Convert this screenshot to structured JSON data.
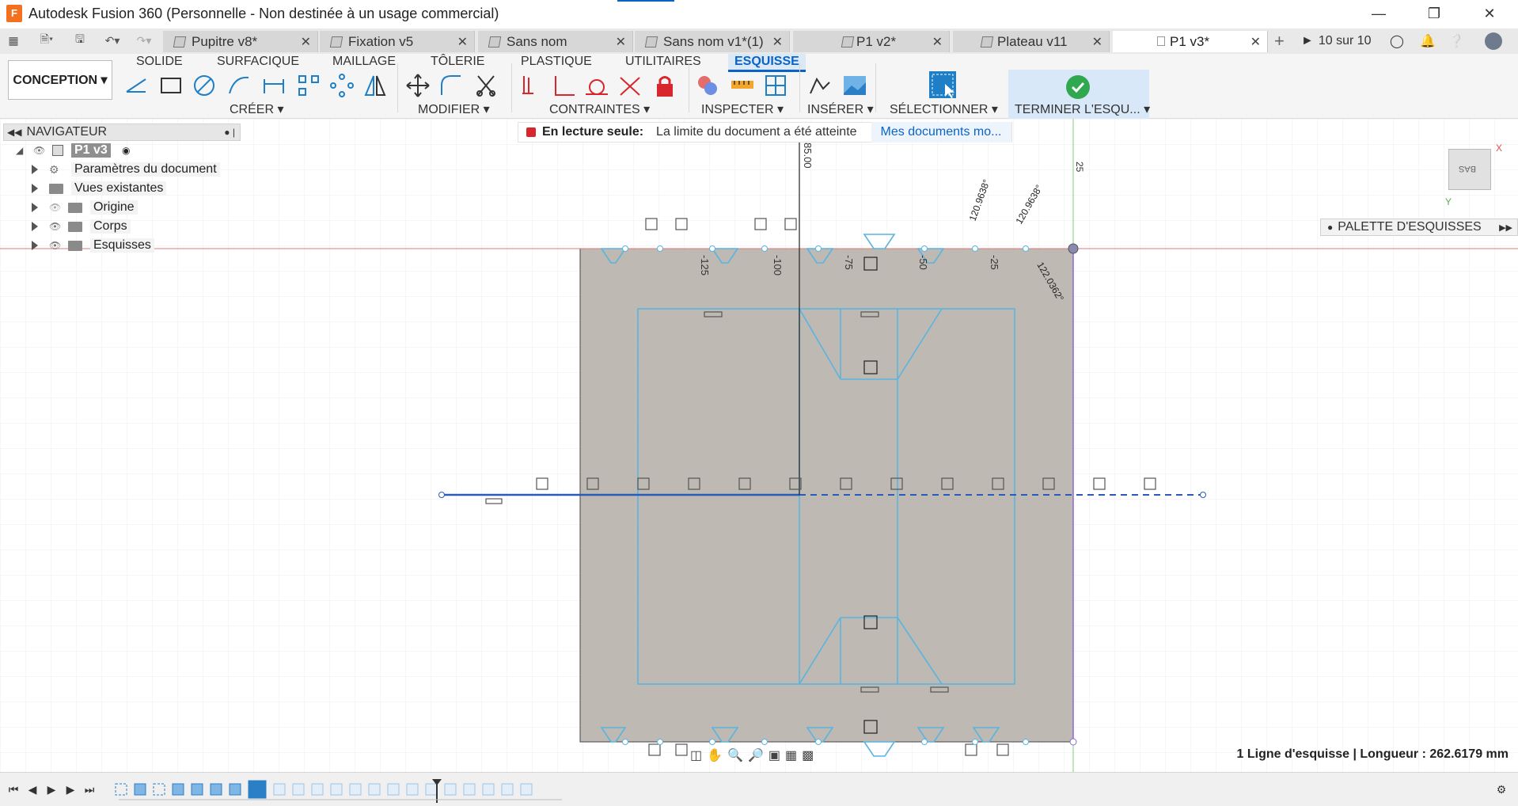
{
  "window": {
    "app_badge": "F",
    "title": "Autodesk Fusion 360 (Personnelle - Non destinée à un usage commercial)",
    "minimize_icon": "minimize-icon",
    "maximize_icon": "restore-icon",
    "close_icon": "close-icon"
  },
  "doc_tabs": [
    {
      "label": "Pupitre v8*"
    },
    {
      "label": "Fixation v5"
    },
    {
      "label": "Sans nom"
    },
    {
      "label": "Sans nom v1*(1)"
    },
    {
      "label": "P1 v2*"
    },
    {
      "label": "Plateau v11"
    },
    {
      "label": "P1 v3*",
      "active": true
    }
  ],
  "tab_strip": {
    "job_status": "10 sur 10"
  },
  "ribbon": {
    "workspace": "CONCEPTION ▾",
    "tabs": [
      "SOLIDE",
      "SURFACIQUE",
      "MAILLAGE",
      "TÔLERIE",
      "PLASTIQUE",
      "UTILITAIRES",
      "ESQUISSE"
    ],
    "active_tab": "ESQUISSE",
    "groups": {
      "create": "CRÉER ▾",
      "modify": "MODIFIER ▾",
      "constraints": "CONTRAINTES ▾",
      "inspect": "INSPECTER ▾",
      "insert": "INSÉRER ▾",
      "select": "SÉLECTIONNER ▾",
      "finish": "TERMINER L'ESQU... ▾"
    }
  },
  "navigator": {
    "title": "NAVIGATEUR",
    "root": "P1 v3",
    "items": [
      {
        "label": "Paramètres du document"
      },
      {
        "label": "Vues existantes"
      },
      {
        "label": "Origine"
      },
      {
        "label": "Corps"
      },
      {
        "label": "Esquisses"
      }
    ]
  },
  "readonly_banner": {
    "title": "En lecture seule:",
    "message": "La limite du document a été atteinte",
    "link": "Mes documents mo..."
  },
  "viewcube": {
    "face": "BAS",
    "axis_x": "X",
    "axis_y": "Y"
  },
  "palette": {
    "label": "PALETTE D'ESQUISSES"
  },
  "sketch": {
    "dimension_vertical": "85.00",
    "dimension_top_right": "25",
    "ruler_labels": [
      "-125",
      "-100",
      "-75",
      "-50",
      "-25"
    ],
    "angle_labels": [
      "120.9638°",
      "120.9638°",
      "122.0362°"
    ]
  },
  "status": {
    "selection_info": "1 Ligne d'esquisse | Longueur : 262.6179 mm"
  },
  "colors": {
    "accent": "#0a64c8",
    "sketch_line": "#5ab4e0",
    "body_fill": "#b3ada4",
    "selected_line": "#2a5bb8",
    "red_axis": "#e07a7a",
    "green_axis": "#7ad07a"
  }
}
